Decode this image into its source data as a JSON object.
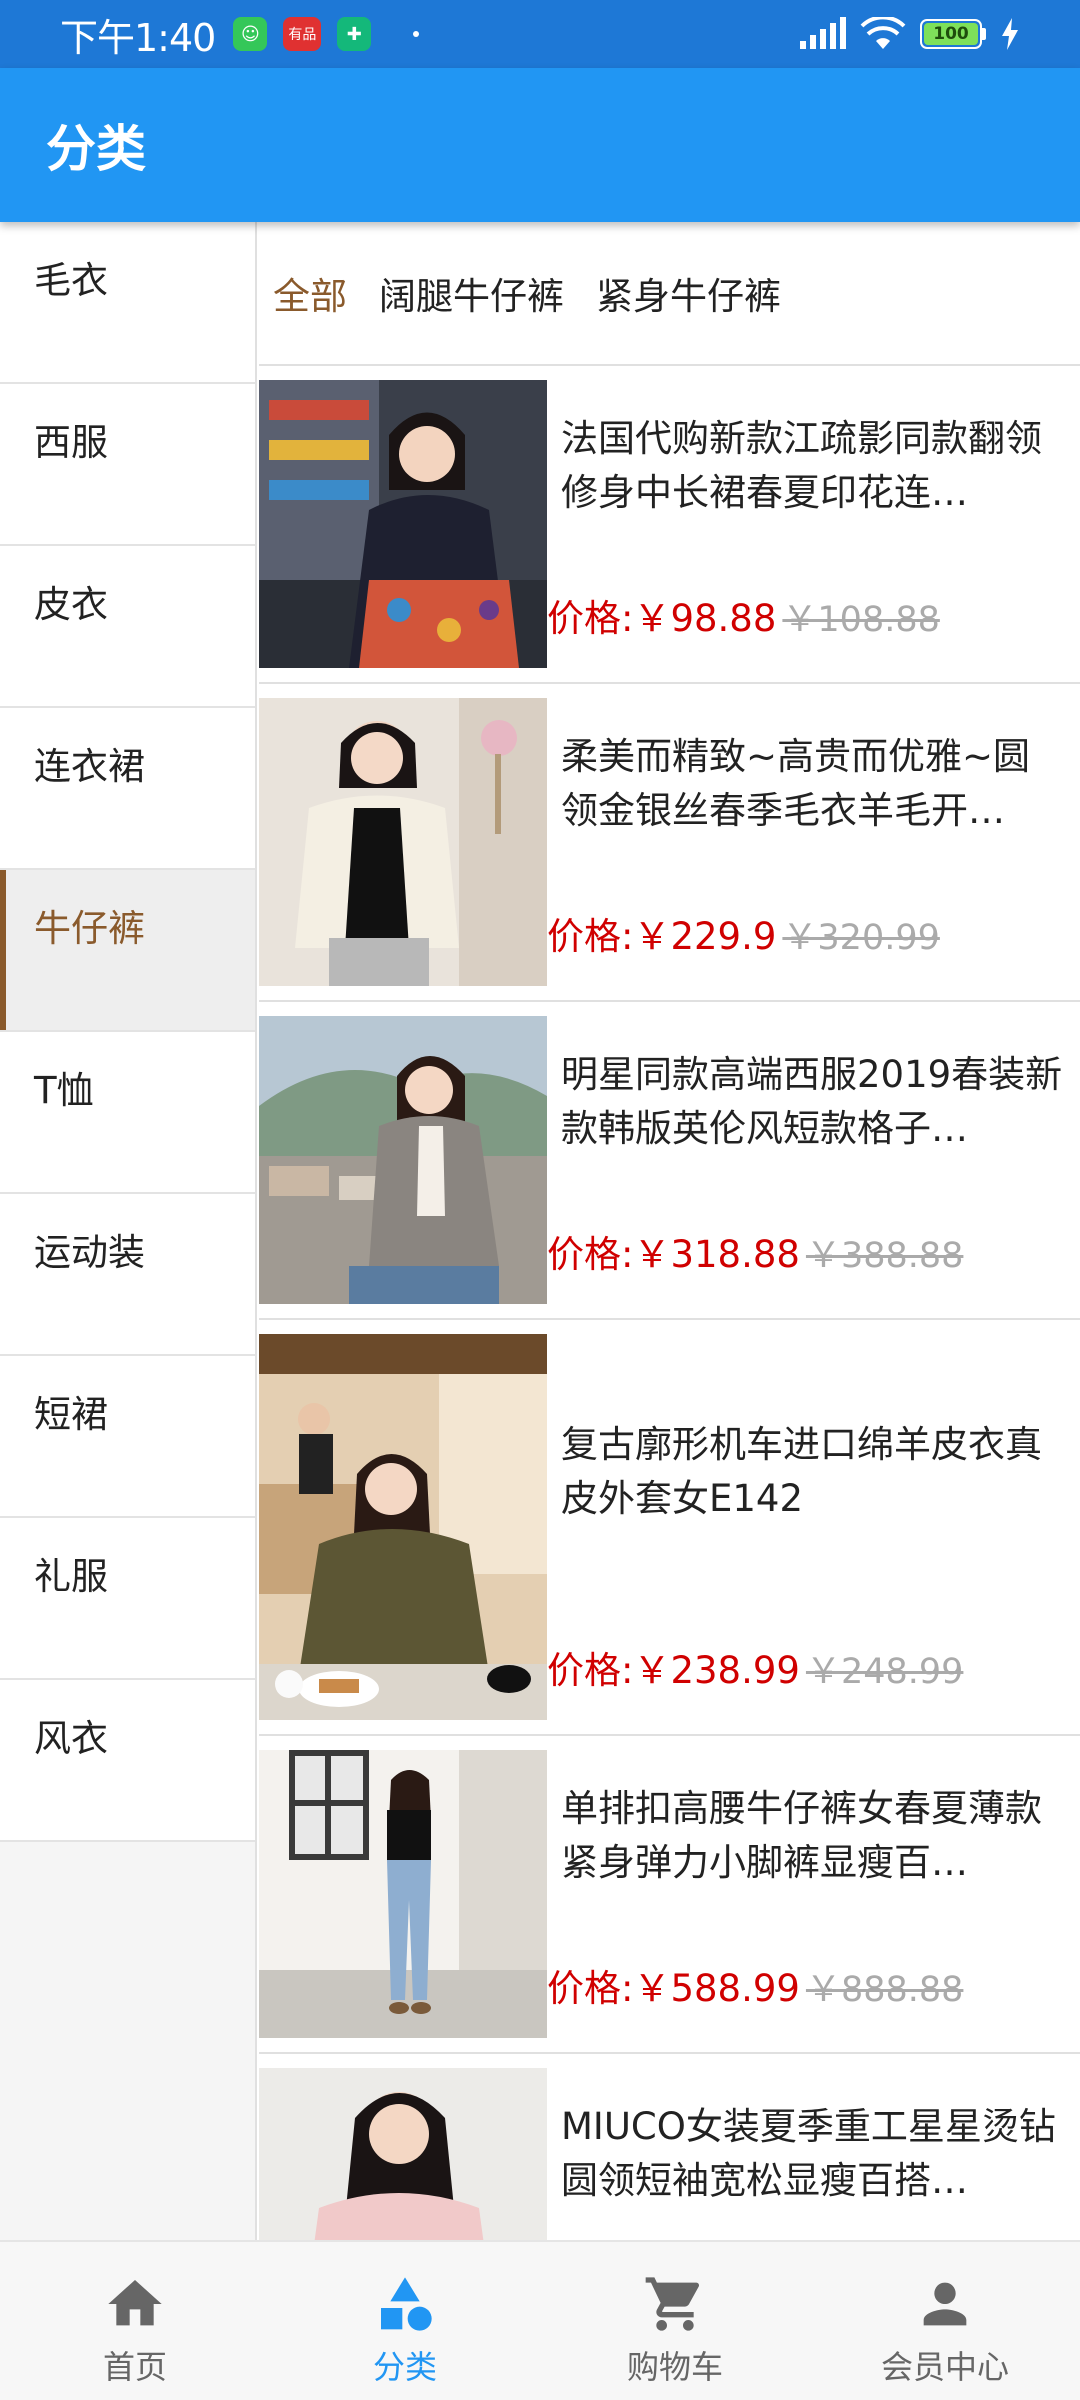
{
  "status_bar": {
    "time": "下午1:40",
    "battery": "100",
    "app_badge_2": "有品"
  },
  "app_bar": {
    "title": "分类"
  },
  "sidebar": {
    "items": [
      {
        "label": "毛衣"
      },
      {
        "label": "西服"
      },
      {
        "label": "皮衣"
      },
      {
        "label": "连衣裙"
      },
      {
        "label": "牛仔裤",
        "active": true
      },
      {
        "label": "T恤"
      },
      {
        "label": "运动装"
      },
      {
        "label": "短裙"
      },
      {
        "label": "礼服"
      },
      {
        "label": "风衣"
      }
    ]
  },
  "subcategories": [
    {
      "label": "全部",
      "active": true
    },
    {
      "label": "阔腿牛仔裤"
    },
    {
      "label": "紧身牛仔裤"
    }
  ],
  "products": [
    {
      "title": "法国代购新款江疏影同款翻领修身中长裙春夏印花连…",
      "price_prefix": "价格:",
      "price": "￥98.88",
      "old_price": "￥108.88"
    },
    {
      "title": "柔美而精致~高贵而优雅~圆领金银丝春季毛衣羊毛开…",
      "price_prefix": "价格:",
      "price": "￥229.9",
      "old_price": "￥320.99"
    },
    {
      "title": "明星同款高端西服2019春装新款韩版英伦风短款格子…",
      "price_prefix": "价格:",
      "price": "￥318.88",
      "old_price": "￥388.88"
    },
    {
      "title": "复古廓形机车进口绵羊皮衣真皮外套女E142",
      "price_prefix": "价格:",
      "price": "￥238.99",
      "old_price": "￥248.99"
    },
    {
      "title": "单排扣高腰牛仔裤女春夏薄款紧身弹力小脚裤显瘦百…",
      "price_prefix": "价格:",
      "price": "￥588.99",
      "old_price": "￥888.88"
    },
    {
      "title": "MIUCO女装夏季重工星星烫钻圆领短袖宽松显瘦百搭…",
      "price_prefix": "价格:",
      "price": "",
      "old_price": ""
    }
  ],
  "tab_bar": {
    "tabs": [
      {
        "label": "首页",
        "icon": "home-icon"
      },
      {
        "label": "分类",
        "icon": "category-icon",
        "active": true
      },
      {
        "label": "购物车",
        "icon": "cart-icon"
      },
      {
        "label": "会员中心",
        "icon": "person-icon"
      }
    ]
  },
  "colors": {
    "primary": "#2196f3",
    "status_bar": "#1e78d6",
    "accent_brown": "#8a5a2c",
    "price_red": "#d00000"
  }
}
